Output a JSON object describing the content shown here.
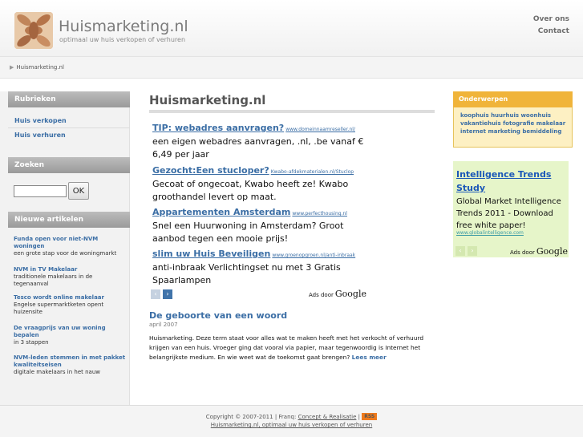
{
  "header": {
    "title": "Huismarketing.nl",
    "tagline": "optimaal uw huis verkopen of verhuren",
    "nav": [
      "Over ons",
      "Contact"
    ]
  },
  "breadcrumb": {
    "current": "Huismarketing.nl"
  },
  "sidebar": {
    "rubrieken": {
      "heading": "Rubrieken",
      "items": [
        "Huis verkopen",
        "Huis verhuren"
      ]
    },
    "zoeken": {
      "heading": "Zoeken",
      "input_value": "",
      "button_label": "OK"
    },
    "nieuwe": {
      "heading": "Nieuwe artikelen",
      "articles": [
        {
          "title": "Funda open voor niet-NVM woningen",
          "desc": "een grote stap voor de woningmarkt"
        },
        {
          "title": "NVM in TV Makelaar",
          "desc": "traditionele makelaars in de tegenaanval"
        },
        {
          "title": "Tesco wordt online makelaar",
          "desc": "Engelse supermarktketen opent huizensite"
        },
        {
          "title": "De vraagprijs van uw woning bepalen",
          "desc": "in 3 stappen"
        },
        {
          "title": "NVM-leden stemmen in met pakket kwaliteitseisen",
          "desc": "digitale makelaars in het nauw"
        }
      ]
    }
  },
  "main": {
    "title": "Huismarketing.nl",
    "ads": [
      {
        "title": "TIP: webadres aanvragen?",
        "url": "www.domeinnaamreseller.nl/",
        "text": "een eigen webadres aanvragen, .nl, .be vanaf € 6,49 per jaar"
      },
      {
        "title": "Gezocht:Een stucloper?",
        "url": "Kwabo-afdekmaterialen.nl/Stuclop",
        "text": "Gecoat of ongecoat, Kwabo heeft ze! Kwabo groothandel levert op maat."
      },
      {
        "title": "Appartementen Amsterdam",
        "url": "www.perfecthousing.nl",
        "text": "Snel een Huurwoning in Amsterdam? Groot aanbod tegen een mooie prijs!"
      },
      {
        "title": "slim uw Huis Beveiligen",
        "url": "www.groenopgroen.nl/anti-inbraak",
        "text": "anti-inbraak Verlichtingset nu met 3 Gratis Spaarlampen"
      }
    ],
    "ads_by": "Ads door",
    "google": "Google",
    "nav_prev": "‹",
    "nav_next": "›",
    "post": {
      "title": "De geboorte van een woord",
      "date": "april 2007",
      "body": "Huismarketing. Deze term staat voor alles wat te maken heeft met het verkocht of verhuurd krijgen van een huis. Vroeger ging dat vooral via papier, maar tegenwoordig is Internet het belangrijkste medium. En wie weet wat de toekomst gaat brengen?",
      "more": "Lees meer"
    }
  },
  "right": {
    "onderwerpen": {
      "heading": "Onderwerpen",
      "tags": [
        "koophuis",
        "huurhuis",
        "woonhuis",
        "vakantiehuis",
        "fotografie",
        "makelaar",
        "internet",
        "marketing",
        "bemiddeling"
      ]
    },
    "ad": {
      "title": "Intelligence Trends Study",
      "text": "Global Market Intelligence Trends 2011 - Download free white paper!",
      "url": "www.globalintelligence.com"
    }
  },
  "footer": {
    "copyright": "Copyright © 2007-2011 | Franq:",
    "credit_link": "Concept & Realisatie",
    "sep": "|",
    "rss": "RSS",
    "line2": "Huismarketing.nl, optimaal uw huis verkopen of verhuren"
  },
  "colors": {
    "link": "#3b6ea5",
    "orange_header": "#f0b43a",
    "orange_box": "#fdf0c3",
    "green_ad": "#e6f5c9",
    "rss": "#ee7a1c"
  }
}
